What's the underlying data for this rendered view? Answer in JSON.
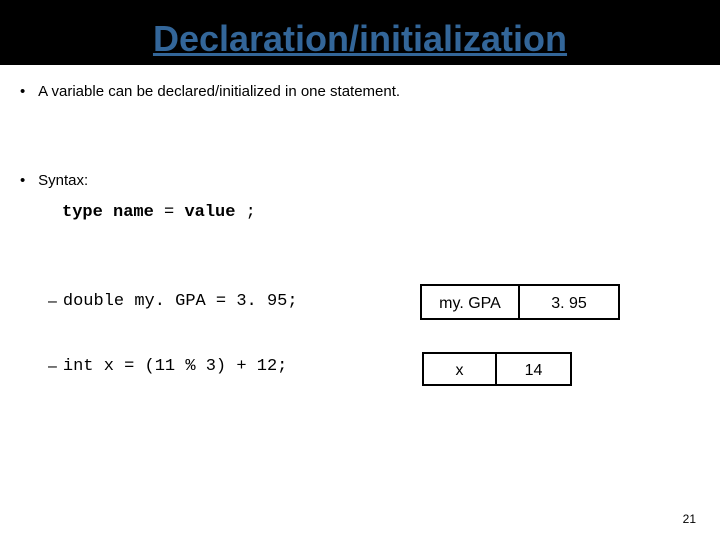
{
  "title": "Declaration/initialization",
  "bullets": {
    "first": "A variable can be declared/initialized in one statement.",
    "second": "Syntax:"
  },
  "syntax": {
    "type": "type",
    "name": "name",
    "eq": " = ",
    "value": "value",
    "semi": ";"
  },
  "examples": {
    "ex1_code": "double my. GPA = 3. 95;",
    "ex2_code": "int x = (11 % 3) + 12;"
  },
  "boxes": {
    "b1_label": "my. GPA",
    "b1_value": "3. 95",
    "b2_label": "x",
    "b2_value": "14"
  },
  "pagenum": "21"
}
